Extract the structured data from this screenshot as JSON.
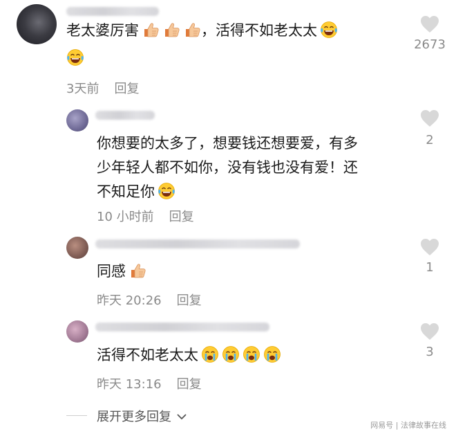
{
  "comments": [
    {
      "text": "老太婆厉害",
      "tail": "，活得不如老太太",
      "time": "3天前",
      "reply": "回复",
      "likes": "2673"
    },
    {
      "line1": "你想要的太多了，想要钱还想要爱，有多",
      "line2": "少年轻人都不如你，没有钱也没有爱！还",
      "line3": "不知足你",
      "time": "10 小时前",
      "reply": "回复",
      "likes": "2"
    },
    {
      "text": "同感",
      "time": "昨天 20:26",
      "reply": "回复",
      "likes": "1"
    },
    {
      "text": "活得不如老太太",
      "time": "昨天 13:16",
      "reply": "回复",
      "likes": "3"
    }
  ],
  "expand_more": "展开更多回复",
  "watermark": "网易号 | 法律故事在线",
  "colors": {
    "heart": "#d8d8d8",
    "meta": "#8a8a8a",
    "text": "#1a1a1a"
  },
  "icons": [
    "thumbs-up-emoji",
    "laughing-tears-emoji",
    "crying-emoji",
    "heart-icon",
    "chevron-down-icon"
  ]
}
